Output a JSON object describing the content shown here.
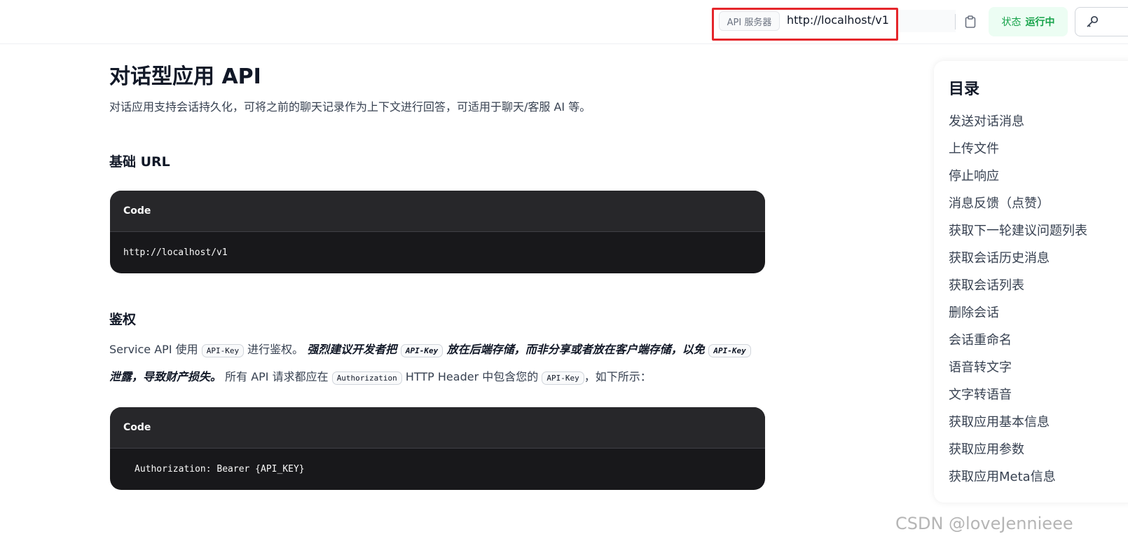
{
  "topbar": {
    "server_label": "API 服务器",
    "server_url": "http://localhost/v1",
    "status_label": "状态",
    "status_value": "运行中",
    "icons": {
      "copy": "clipboard-icon",
      "key": "key-icon"
    }
  },
  "main": {
    "title": "对话型应用 API",
    "description": "对话应用支持会话持久化，可将之前的聊天记录作为上下文进行回答，可适用于聊天/客服 AI 等。",
    "base_url": {
      "heading": "基础 URL",
      "code_label": "Code",
      "code": "http://localhost/v1"
    },
    "auth": {
      "heading": "鉴权",
      "p1": "Service API 使用 ",
      "c1": "API-Key",
      "p2": " 进行鉴权。 ",
      "s1": "强烈建议开发者把 ",
      "c2": "API-Key",
      "s2": " 放在后端存储，而非分享或者放在客户端存储，以免 ",
      "c3": "API-Key",
      "s3": " 泄露，导致财产损失。",
      "p3": " 所有 API 请求都应在 ",
      "c4": "Authorization",
      "p4": " HTTP Header 中包含您的 ",
      "c5": "API-Key",
      "p5": "，如下所示：",
      "code_label": "Code",
      "code": "Authorization: Bearer {API_KEY}"
    }
  },
  "toc": {
    "title": "目录",
    "items": [
      "发送对话消息",
      "上传文件",
      "停止响应",
      "消息反馈（点赞）",
      "获取下一轮建议问题列表",
      "获取会话历史消息",
      "获取会话列表",
      "删除会话",
      "会话重命名",
      "语音转文字",
      "文字转语音",
      "获取应用基本信息",
      "获取应用参数",
      "获取应用Meta信息"
    ]
  },
  "watermark": "CSDN @loveJennieee",
  "colors": {
    "highlight_border": "#e5262b",
    "status_green": "#16a34a",
    "code_bg": "#18181b"
  }
}
